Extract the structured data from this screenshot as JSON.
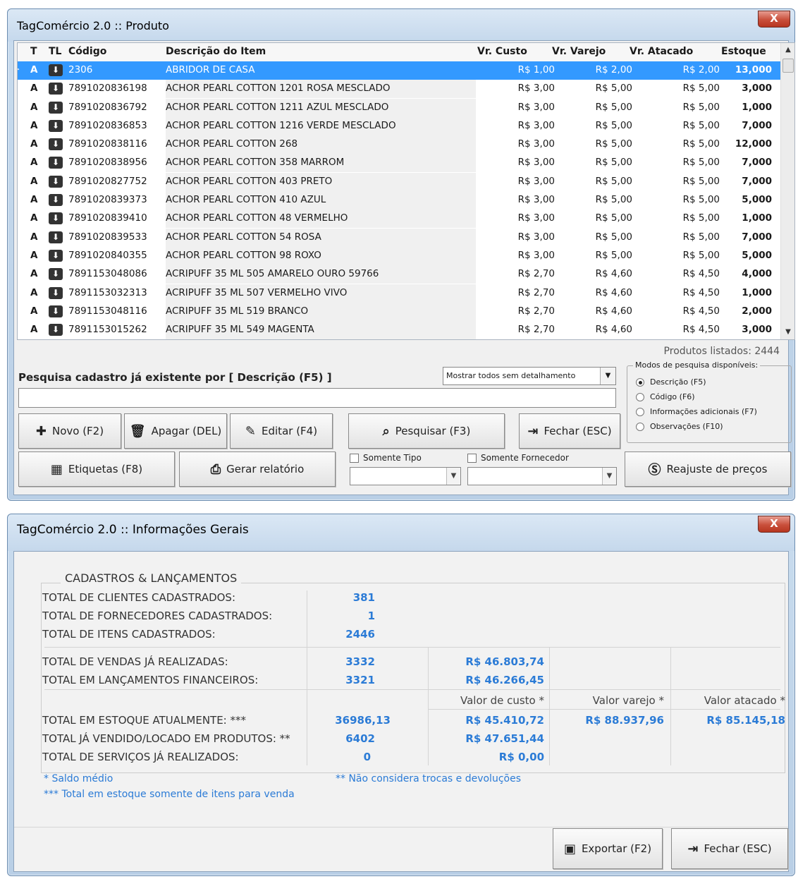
{
  "product_window": {
    "title": "TagComércio 2.0 :: Produto",
    "close_label": "X",
    "columns": {
      "t": "T",
      "tl": "TL",
      "code": "Código",
      "desc": "Descrição do Item",
      "cost": "Vr. Custo",
      "retail": "Vr. Varejo",
      "wholesale": "Vr. Atacado",
      "stock": "Estoque"
    },
    "rows": [
      {
        "t": "A",
        "code": "2306",
        "desc": "ABRIDOR DE CASA",
        "cost": "R$ 1,00",
        "retail": "R$ 2,00",
        "wholesale": "R$ 2,00",
        "stock": "13,000",
        "selected": true
      },
      {
        "t": "A",
        "code": "7891020836198",
        "desc": "ACHOR PEARL COTTON 1201 ROSA MESCLADO",
        "cost": "R$ 3,00",
        "retail": "R$ 5,00",
        "wholesale": "R$ 5,00",
        "stock": "3,000"
      },
      {
        "t": "A",
        "code": "7891020836792",
        "desc": "ACHOR PEARL COTTON 1211 AZUL MESCLADO",
        "cost": "R$ 3,00",
        "retail": "R$ 5,00",
        "wholesale": "R$ 5,00",
        "stock": "1,000"
      },
      {
        "t": "A",
        "code": "7891020836853",
        "desc": "ACHOR PEARL COTTON 1216 VERDE MESCLADO",
        "cost": "R$ 3,00",
        "retail": "R$ 5,00",
        "wholesale": "R$ 5,00",
        "stock": "7,000"
      },
      {
        "t": "A",
        "code": "7891020838116",
        "desc": "ACHOR PEARL COTTON 268",
        "cost": "R$ 3,00",
        "retail": "R$ 5,00",
        "wholesale": "R$ 5,00",
        "stock": "12,000"
      },
      {
        "t": "A",
        "code": "7891020838956",
        "desc": "ACHOR PEARL COTTON 358 MARROM",
        "cost": "R$ 3,00",
        "retail": "R$ 5,00",
        "wholesale": "R$ 5,00",
        "stock": "7,000"
      },
      {
        "t": "A",
        "code": "7891020827752",
        "desc": "ACHOR PEARL COTTON 403 PRETO",
        "cost": "R$ 3,00",
        "retail": "R$ 5,00",
        "wholesale": "R$ 5,00",
        "stock": "7,000"
      },
      {
        "t": "A",
        "code": "7891020839373",
        "desc": "ACHOR PEARL COTTON 410 AZUL",
        "cost": "R$ 3,00",
        "retail": "R$ 5,00",
        "wholesale": "R$ 5,00",
        "stock": "5,000"
      },
      {
        "t": "A",
        "code": "7891020839410",
        "desc": "ACHOR PEARL COTTON 48 VERMELHO",
        "cost": "R$ 3,00",
        "retail": "R$ 5,00",
        "wholesale": "R$ 5,00",
        "stock": "1,000"
      },
      {
        "t": "A",
        "code": "7891020839533",
        "desc": "ACHOR PEARL COTTON 54 ROSA",
        "cost": "R$ 3,00",
        "retail": "R$ 5,00",
        "wholesale": "R$ 5,00",
        "stock": "7,000"
      },
      {
        "t": "A",
        "code": "7891020840355",
        "desc": "ACHOR PEARL COTTON 98 ROXO",
        "cost": "R$ 3,00",
        "retail": "R$ 5,00",
        "wholesale": "R$ 5,00",
        "stock": "5,000"
      },
      {
        "t": "A",
        "code": "7891153048086",
        "desc": "ACRIPUFF 35 ML 505 AMARELO OURO 59766",
        "cost": "R$ 2,70",
        "retail": "R$ 4,60",
        "wholesale": "R$ 4,50",
        "stock": "4,000"
      },
      {
        "t": "A",
        "code": "7891153032313",
        "desc": "ACRIPUFF 35 ML 507 VERMELHO VIVO",
        "cost": "R$ 2,70",
        "retail": "R$ 4,60",
        "wholesale": "R$ 4,50",
        "stock": "1,000"
      },
      {
        "t": "A",
        "code": "7891153048116",
        "desc": "ACRIPUFF 35 ML 519 BRANCO",
        "cost": "R$ 2,70",
        "retail": "R$ 4,60",
        "wholesale": "R$ 4,50",
        "stock": "2,000"
      },
      {
        "t": "A",
        "code": "7891153015262",
        "desc": "ACRIPUFF 35 ML 549 MAGENTA",
        "cost": "R$ 2,70",
        "retail": "R$ 4,60",
        "wholesale": "R$ 4,50",
        "stock": "3,000"
      }
    ],
    "listed": "Produtos listados: 2444",
    "search_label": "Pesquisa cadastro já existente por [ Descrição (F5) ]",
    "search_value": "",
    "display_mode": "Mostrar todos sem detalhamento",
    "buttons": {
      "new": "Novo (F2)",
      "delete": "Apagar (DEL)",
      "edit": "Editar (F4)",
      "search": "Pesquisar (F3)",
      "close": "Fechar (ESC)",
      "labels": "Etiquetas (F8)",
      "report": "Gerar relatório",
      "readjust": "Reajuste de preços"
    },
    "filters": {
      "only_type": "Somente Tipo",
      "only_supplier": "Somente Fornecedor"
    },
    "modes_legend": "Modos de pesquisa disponíveis:",
    "modes": [
      {
        "label": "Descrição (F5)",
        "checked": true
      },
      {
        "label": "Código (F6)",
        "checked": false
      },
      {
        "label": "Informações adicionais (F7)",
        "checked": false
      },
      {
        "label": "Observações (F10)",
        "checked": false
      }
    ]
  },
  "info_window": {
    "title": "TagComércio 2.0 :: Informações Gerais",
    "close_label": "X",
    "group_label": "CADASTROS & LANÇAMENTOS",
    "labels": {
      "clients": "TOTAL DE CLIENTES CADASTRADOS:",
      "suppliers": "TOTAL DE FORNECEDORES CADASTRADOS:",
      "items": "TOTAL DE ITENS CADASTRADOS:",
      "sales": "TOTAL DE VENDAS JÁ REALIZADAS:",
      "financial": "TOTAL EM LANÇAMENTOS FINANCEIROS:",
      "stock": "TOTAL EM ESTOQUE ATUALMENTE: ***",
      "sold": "TOTAL JÁ VENDIDO/LOCADO EM PRODUTOS: **",
      "services": "TOTAL DE SERVIÇOS JÁ REALIZADOS:"
    },
    "values": {
      "clients": "381",
      "suppliers": "1",
      "items": "2446",
      "sales_count": "3332",
      "sales_value": "R$ 46.803,74",
      "financial_count": "3321",
      "financial_value": "R$ 46.266,45",
      "stock_qty": "36986,13",
      "stock_cost": "R$ 45.410,72",
      "stock_retail": "R$ 88.937,96",
      "stock_wholesale": "R$ 85.145,18",
      "sold_qty": "6402",
      "sold_value": "R$ 47.651,44",
      "services_qty": "0",
      "services_value": "R$ 0,00"
    },
    "headers": {
      "cost": "Valor de custo *",
      "retail": "Valor varejo *",
      "wholesale": "Valor atacado *"
    },
    "notes": {
      "avg": "* Saldo médio",
      "stock_only": "*** Total em estoque somente de itens para venda",
      "no_returns": "** Não considera trocas e devoluções"
    },
    "buttons": {
      "export": "Exportar (F2)",
      "close": "Fechar (ESC)"
    }
  }
}
